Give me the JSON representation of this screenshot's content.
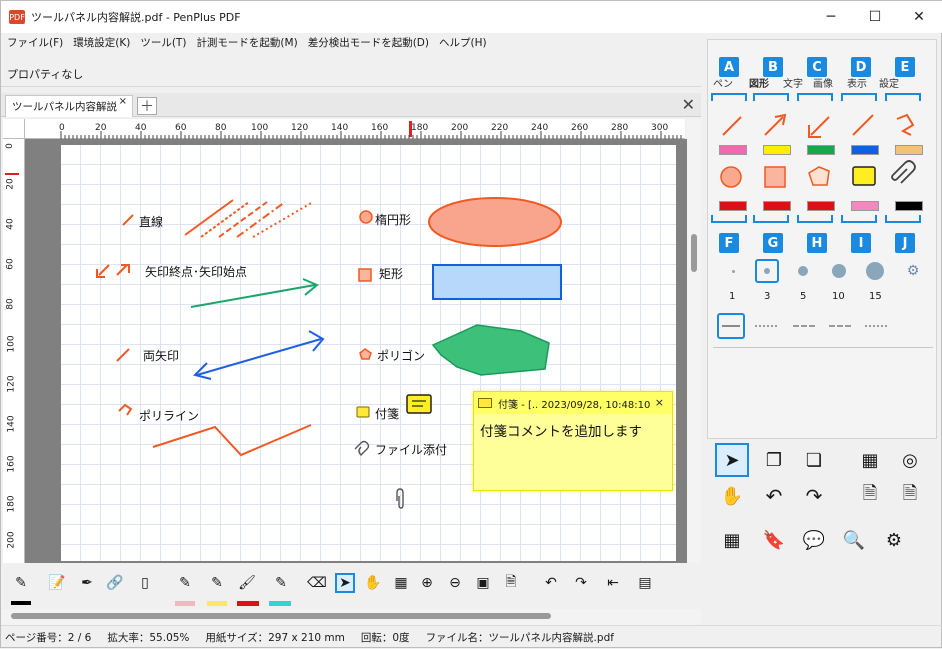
{
  "window": {
    "title": "ツールパネル内容解説.pdf - PenPlus PDF",
    "app_icon": "PDF",
    "min": "─",
    "max": "☐",
    "close": "✕"
  },
  "menu": [
    "ファイル(F)",
    "環境設定(K)",
    "ツール(T)",
    "計測モードを起動(M)",
    "差分検出モードを起動(D)",
    "ヘルプ(H)"
  ],
  "properties": {
    "label": "プロパティなし"
  },
  "tabs": {
    "active": "ツールパネル内容解説",
    "close": "×",
    "add": "＋",
    "close_all": "✕"
  },
  "ruler_h": [
    "0",
    "20",
    "40",
    "60",
    "80",
    "100",
    "120",
    "140",
    "160",
    "180",
    "200",
    "220",
    "240",
    "260",
    "280",
    "300"
  ],
  "ruler_v": [
    "0",
    "20",
    "40",
    "60",
    "80",
    "100",
    "120",
    "140",
    "160",
    "180",
    "200"
  ],
  "page": {
    "labels": {
      "line": "直線",
      "arrow": "矢印終点･矢印始点",
      "double": "両矢印",
      "polyline": "ポリライン",
      "ellipse": "楕円形",
      "rect": "矩形",
      "polygon": "ポリゴン",
      "note": "付箋",
      "attach": "ファイル添付"
    }
  },
  "sticky": {
    "title": "付箋 - [.. 2023/09/28, 10:48:10",
    "close": "×",
    "text": "付箋コメントを追加します"
  },
  "status": {
    "page": "ページ番号：2 / 6",
    "zoom": "拡大率：55.05%",
    "paper": "用紙サイズ：297 x 210 mm",
    "rotate": "回転：0度",
    "file": "ファイル名：ツールパネル内容解説.pdf"
  },
  "panel": {
    "tabs": [
      "ペン",
      "図形",
      "文字",
      "画像",
      "表示",
      "設定"
    ],
    "letters_top": [
      "A",
      "B",
      "C",
      "D",
      "E"
    ],
    "letters_bottom": [
      "F",
      "G",
      "H",
      "I",
      "J"
    ],
    "sizes": [
      "1",
      "3",
      "5",
      "10",
      "15"
    ],
    "toggle": "»",
    "swatches_top": [
      "#f06ab0",
      "#ffee00",
      "#1aa64c",
      "#1060e0",
      "#f7c07a"
    ],
    "swatches_bottom": [
      "#e01010",
      "#e01010",
      "#e01010",
      "#f08abe",
      "#000000"
    ]
  },
  "colors": {
    "accent": "#1a8ae0",
    "shape": "#f05a22"
  }
}
